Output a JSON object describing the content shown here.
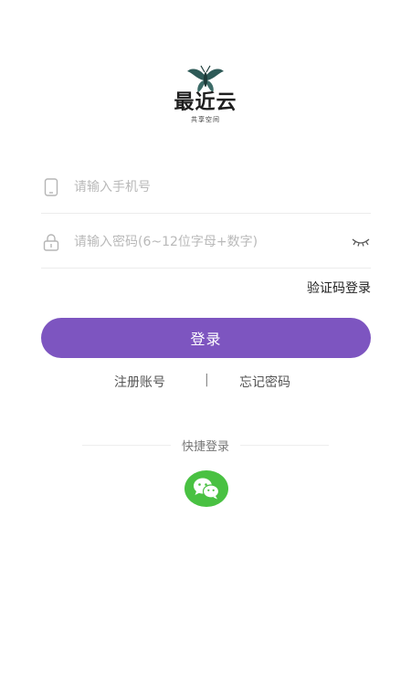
{
  "brand": {
    "name": "最近云",
    "subtitle": "共享空间",
    "accent_color": "#7d55c0",
    "logo_icon": "butterfly-logo-icon"
  },
  "form": {
    "phone": {
      "placeholder": "请输入手机号",
      "value": "",
      "icon": "phone-icon"
    },
    "password": {
      "placeholder": "请输入密码(6~12位字母+数字)",
      "value": "",
      "icon": "lock-icon",
      "toggle_icon": "eye-closed-icon"
    },
    "sms_login_label": "验证码登录",
    "login_label": "登录"
  },
  "links": {
    "register_label": "注册账号",
    "separator": "|",
    "forgot_label": "忘记密码"
  },
  "quick_login": {
    "label": "快捷登录",
    "wechat_icon": "wechat-icon",
    "wechat_color": "#49c142"
  }
}
